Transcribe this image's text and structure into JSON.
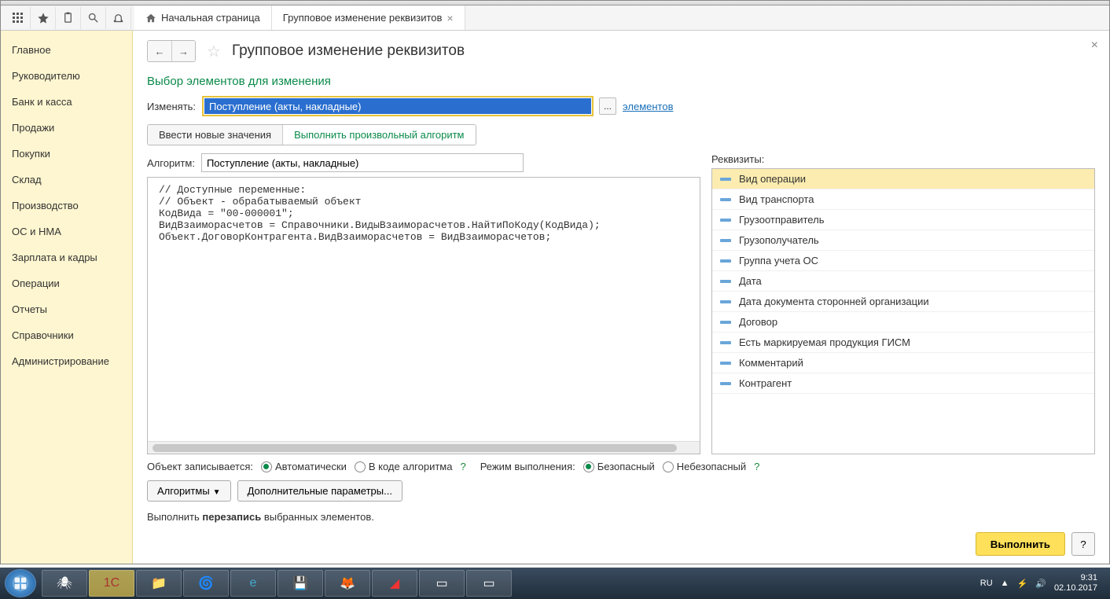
{
  "toolbar": {
    "tabs": [
      {
        "label": "Начальная страница",
        "closable": false,
        "home": true
      },
      {
        "label": "Групповое изменение реквизитов",
        "closable": true,
        "home": false
      }
    ]
  },
  "sidebar": {
    "items": [
      "Главное",
      "Руководителю",
      "Банк и касса",
      "Продажи",
      "Покупки",
      "Склад",
      "Производство",
      "ОС и НМА",
      "Зарплата и кадры",
      "Операции",
      "Отчеты",
      "Справочники",
      "Администрирование"
    ]
  },
  "page": {
    "title": "Групповое изменение реквизитов",
    "section_title": "Выбор элементов для изменения",
    "change_label": "Изменять:",
    "change_value": "Поступление (акты, накладные)",
    "elements_link": "элементов",
    "tab_values": "Ввести новые значения",
    "tab_algo": "Выполнить произвольный алгоритм",
    "algo_label": "Алгоритм:",
    "algo_value": "Поступление (акты, накладные)",
    "code": "// Доступные переменные:\n// Объект - обрабатываемый объект\nКодВида = \"00-000001\";\nВидВзаиморасчетов = Справочники.ВидыВзаиморасчетов.НайтиПоКоду(КодВида);\nОбъект.ДоговорКонтрагента.ВидВзаиморасчетов = ВидВзаиморасчетов;",
    "req_label": "Реквизиты:",
    "requisites": [
      "Вид операции",
      "Вид транспорта",
      "Грузоотправитель",
      "Грузополучатель",
      "Группа учета ОС",
      "Дата",
      "Дата документа сторонней организации",
      "Договор",
      "Есть маркируемая продукция ГИСМ",
      "Комментарий",
      "Контрагент"
    ],
    "opts": {
      "save_label": "Объект записывается:",
      "auto": "Автоматически",
      "in_code": "В коде алгоритма",
      "mode_label": "Режим выполнения:",
      "safe": "Безопасный",
      "unsafe": "Небезопасный"
    },
    "actions": {
      "algos": "Алгоритмы",
      "extra": "Дополнительные параметры..."
    },
    "footer_pre": "Выполнить ",
    "footer_bold": "перезапись",
    "footer_post": " выбранных элементов.",
    "execute": "Выполнить",
    "help": "?"
  },
  "tray": {
    "lang": "RU",
    "time": "9:31",
    "date": "02.10.2017"
  }
}
